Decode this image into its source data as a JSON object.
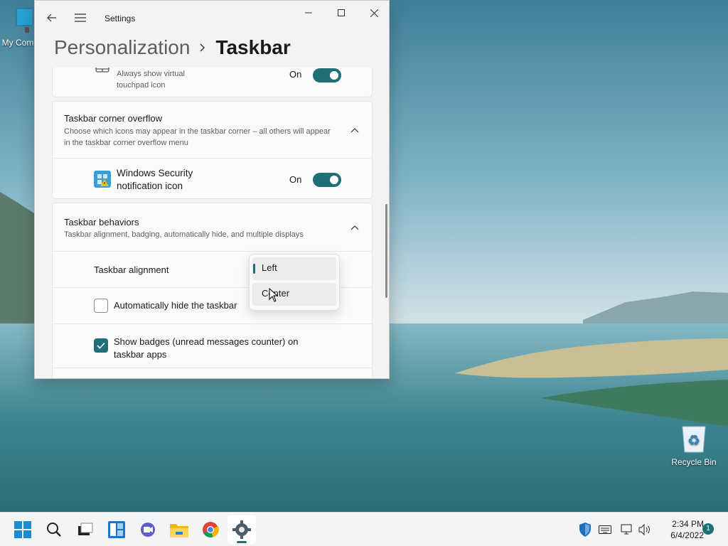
{
  "desktop": {
    "icons": [
      {
        "label": "My Com"
      },
      {
        "label": "Recycle Bin"
      }
    ]
  },
  "window": {
    "app_title": "Settings",
    "breadcrumb": {
      "parent": "Personalization",
      "current": "Taskbar"
    }
  },
  "touchpad_row": {
    "label": "Always show virtual touchpad icon",
    "state": "On"
  },
  "corner_overflow": {
    "title": "Taskbar corner overflow",
    "description": "Choose which icons may appear in the taskbar corner – all others will appear in the taskbar corner overflow menu",
    "items": [
      {
        "label": "Windows Security notification icon",
        "state": "On"
      }
    ]
  },
  "behaviors": {
    "title": "Taskbar behaviors",
    "description": "Taskbar alignment, badging, automatically hide, and multiple displays",
    "alignment_label": "Taskbar alignment",
    "alignment_options": [
      "Left",
      "Center"
    ],
    "alignment_selected": "Left",
    "auto_hide_label": "Automatically hide the taskbar",
    "auto_hide_checked": false,
    "badges_label": "Show badges (unread messages counter) on taskbar apps",
    "badges_checked": true
  },
  "taskbar": {
    "apps": [
      "start",
      "search",
      "task-view",
      "widgets",
      "chat",
      "file-explorer",
      "chrome",
      "settings"
    ],
    "clock": {
      "time": "2:34 PM",
      "date": "6/4/2022"
    },
    "notification_count": "1"
  },
  "colors": {
    "accent": "#1e6f77",
    "window_bg": "#f3f3f3",
    "card_bg": "#fbfbfb",
    "taskbar_bg": "#f2f4f6"
  }
}
